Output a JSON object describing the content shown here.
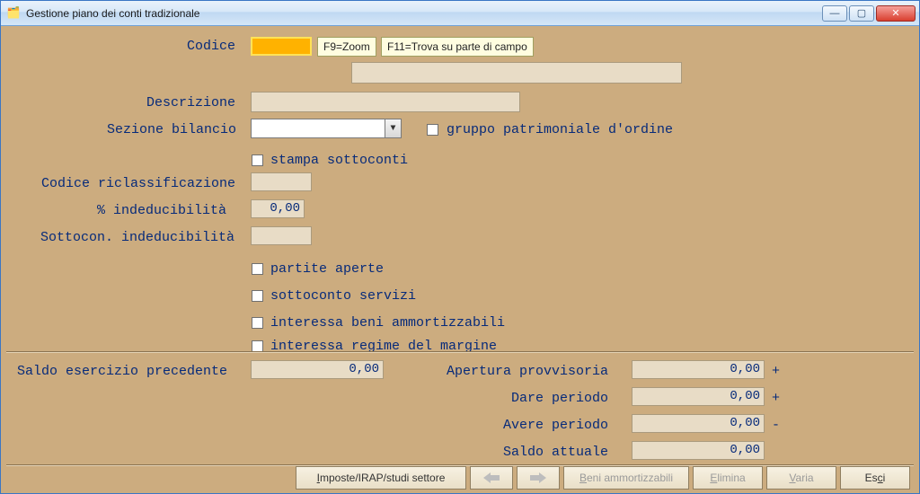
{
  "window": {
    "title": "Gestione piano dei conti tradizionale"
  },
  "labels": {
    "codice": "Codice",
    "descrizione": "Descrizione",
    "sezione_bilancio": "Sezione bilancio",
    "gruppo_patrimoniale": "gruppo patrimoniale d'ordine",
    "stampa_sottoconti": "stampa sottoconti",
    "codice_riclass": "Codice riclassificazione",
    "pct_inded": "% indeducibilità",
    "sottocon_inded": "Sottocon. indeducibilità",
    "partite_aperte": "partite aperte",
    "sottoconto_servizi": "sottoconto servizi",
    "interessa_beni": "interessa beni ammortizzabili",
    "interessa_regime": "interessa regime del margine",
    "saldo_esercizio": "Saldo esercizio precedente",
    "apertura_provv": "Apertura provvisoria",
    "dare_periodo": "Dare periodo",
    "avere_periodo": "Avere periodo",
    "saldo_attuale": "Saldo attuale"
  },
  "hints": {
    "f9": "F9=Zoom",
    "f11": "F11=Trova su parte di campo"
  },
  "values": {
    "codice": "",
    "codice_ext": "",
    "descrizione": "",
    "sezione_bilancio": "",
    "codice_riclass": "",
    "pct_inded": "0,00",
    "sottocon_inded": "",
    "saldo_esercizio": "0,00",
    "apertura_provv": "0,00",
    "dare_periodo": "0,00",
    "avere_periodo": "0,00",
    "saldo_attuale": "0,00"
  },
  "signs": {
    "apertura": "+",
    "dare": "+",
    "avere": "-"
  },
  "buttons": {
    "imposte": "Imposte/IRAP/studi settore",
    "beni": "Beni ammortizzabili",
    "elimina": "Elimina",
    "varia": "Varia",
    "esci": "Esci"
  }
}
